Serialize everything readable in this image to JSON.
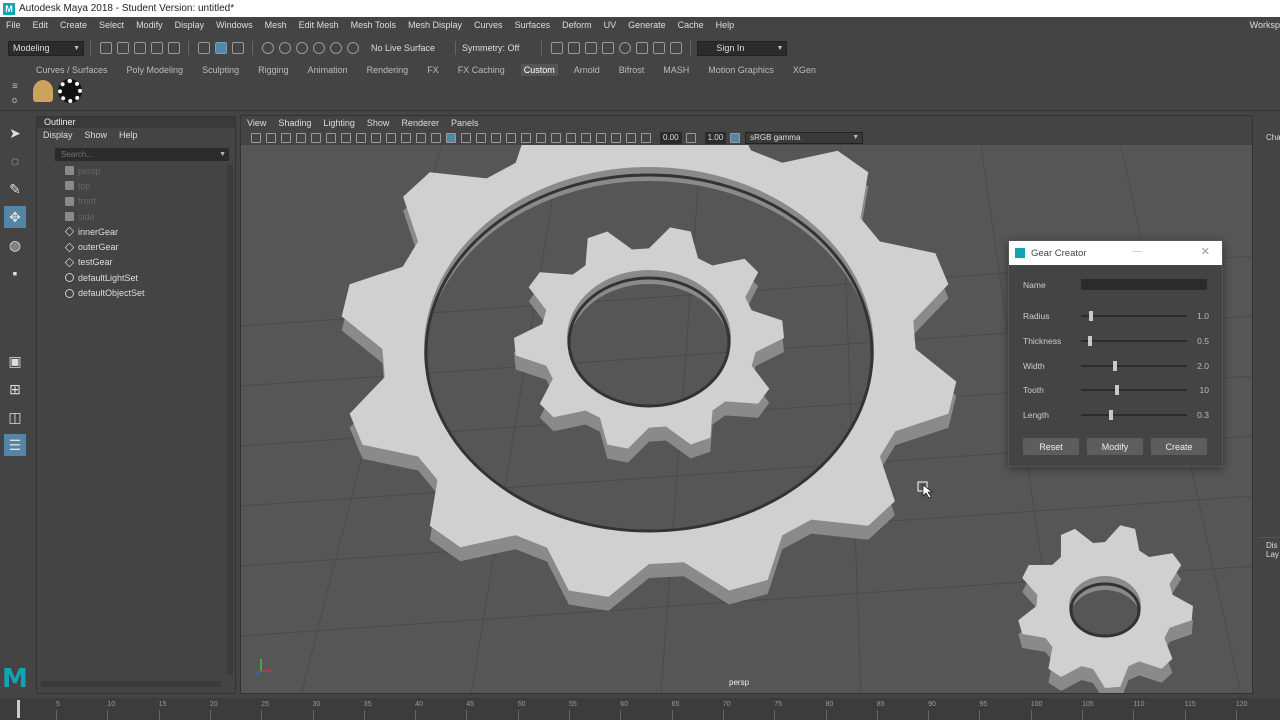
{
  "window": {
    "title": "Autodesk Maya 2018 - Student Version: untitled*"
  },
  "menubar": {
    "items": [
      "File",
      "Edit",
      "Create",
      "Select",
      "Modify",
      "Display",
      "Windows",
      "Mesh",
      "Edit Mesh",
      "Mesh Tools",
      "Mesh Display",
      "Curves",
      "Surfaces",
      "Deform",
      "UV",
      "Generate",
      "Cache",
      "Help"
    ],
    "workspace": "Worksp"
  },
  "statusline": {
    "mode": "Modeling",
    "live_surface": "No Live Surface",
    "symmetry": "Symmetry: Off",
    "sign_in": "Sign In"
  },
  "shelf": {
    "tabs": [
      "Curves / Surfaces",
      "Poly Modeling",
      "Sculpting",
      "Rigging",
      "Animation",
      "Rendering",
      "FX",
      "FX Caching",
      "Custom",
      "Arnold",
      "Bifrost",
      "MASH",
      "Motion Graphics",
      "XGen"
    ],
    "active": "Custom"
  },
  "outliner": {
    "title": "Outliner",
    "menu": [
      "Display",
      "Show",
      "Help"
    ],
    "search_placeholder": "Search...",
    "items": [
      {
        "label": "persp",
        "kind": "cam",
        "dim": true
      },
      {
        "label": "top",
        "kind": "cam",
        "dim": true
      },
      {
        "label": "front",
        "kind": "cam",
        "dim": true
      },
      {
        "label": "side",
        "kind": "cam",
        "dim": true
      },
      {
        "label": "innerGear",
        "kind": "mesh",
        "dim": false
      },
      {
        "label": "outerGear",
        "kind": "mesh",
        "dim": false
      },
      {
        "label": "testGear",
        "kind": "mesh",
        "dim": false
      },
      {
        "label": "defaultLightSet",
        "kind": "set",
        "dim": false
      },
      {
        "label": "defaultObjectSet",
        "kind": "set",
        "dim": false
      }
    ]
  },
  "viewport": {
    "menu": [
      "View",
      "Shading",
      "Lighting",
      "Show",
      "Renderer",
      "Panels"
    ],
    "exposure": "0.00",
    "gamma": "1.00",
    "color_space": "sRGB gamma",
    "camera_label": "persp"
  },
  "gear_creator": {
    "title": "Gear Creator",
    "name_label": "Name",
    "name_value": "",
    "params": [
      {
        "label": "Radius",
        "value": "1.0",
        "fraction": 0.08
      },
      {
        "label": "Thickness",
        "value": "0.5",
        "fraction": 0.07
      },
      {
        "label": "Width",
        "value": "2.0",
        "fraction": 0.31
      },
      {
        "label": "Tooth",
        "value": "10",
        "fraction": 0.33
      },
      {
        "label": "Length",
        "value": "0.3",
        "fraction": 0.27
      }
    ],
    "buttons": {
      "reset": "Reset",
      "modify": "Modify",
      "create": "Create"
    }
  },
  "rightstrip": {
    "top": "Cha",
    "mid1": "Dis",
    "mid2": "Lay"
  },
  "timeline": {
    "ticks": [
      "5",
      "10",
      "15",
      "20",
      "25",
      "30",
      "35",
      "40",
      "45",
      "50",
      "55",
      "60",
      "65",
      "70",
      "75",
      "80",
      "85",
      "90",
      "95",
      "100",
      "105",
      "110",
      "115",
      "120"
    ]
  },
  "colors": {
    "accent": "#11a4b5",
    "selected": "#5285a6",
    "gear": "#d0d0d0",
    "viewport_bg": "#565656"
  }
}
